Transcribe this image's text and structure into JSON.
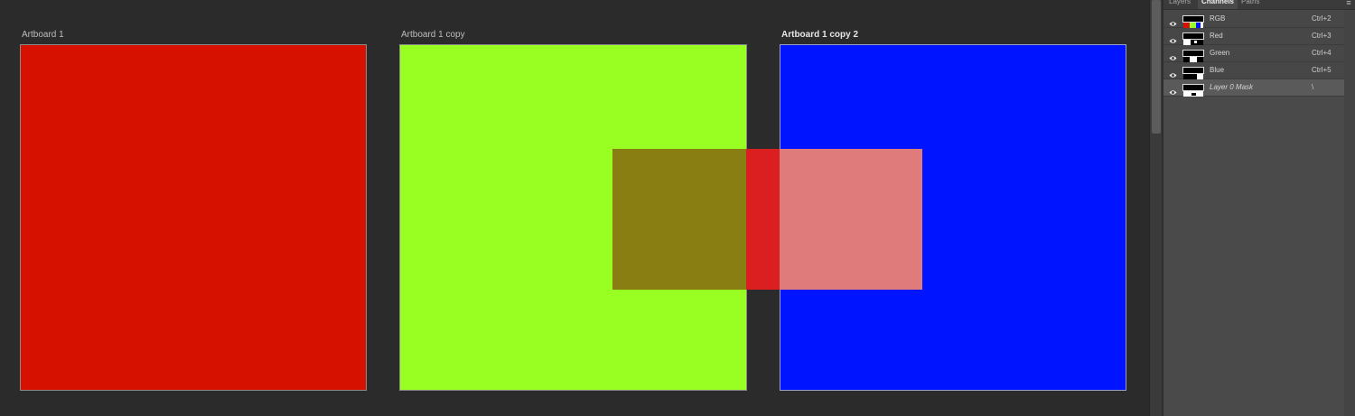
{
  "artboards": [
    {
      "label": "Artboard 1",
      "fill": "#d61100",
      "active": false
    },
    {
      "label": "Artboard 1 copy",
      "fill": "#99ff22",
      "active": false
    },
    {
      "label": "Artboard 1 copy 2",
      "fill": "#0014ff",
      "active": true
    }
  ],
  "overlay": {
    "left_color": "#897e11",
    "middle_color": "#db1f20",
    "right_color": "#e07b7b"
  },
  "panel": {
    "tabs": [
      {
        "label": "Layers",
        "active": false
      },
      {
        "label": "Channels",
        "active": true
      },
      {
        "label": "Paths",
        "active": false
      }
    ],
    "menu_icon": "panel-menu-icon",
    "channels": [
      {
        "name": "RGB",
        "shortcut": "Ctrl+2",
        "visible": true,
        "selected": false,
        "thumb": "rgb"
      },
      {
        "name": "Red",
        "shortcut": "Ctrl+3",
        "visible": true,
        "selected": false,
        "thumb": "red"
      },
      {
        "name": "Green",
        "shortcut": "Ctrl+4",
        "visible": true,
        "selected": false,
        "thumb": "green"
      },
      {
        "name": "Blue",
        "shortcut": "Ctrl+5",
        "visible": true,
        "selected": false,
        "thumb": "blue"
      },
      {
        "name": "Layer 0 Mask",
        "shortcut": "\\",
        "visible": true,
        "selected": true,
        "thumb": "mask"
      }
    ]
  }
}
